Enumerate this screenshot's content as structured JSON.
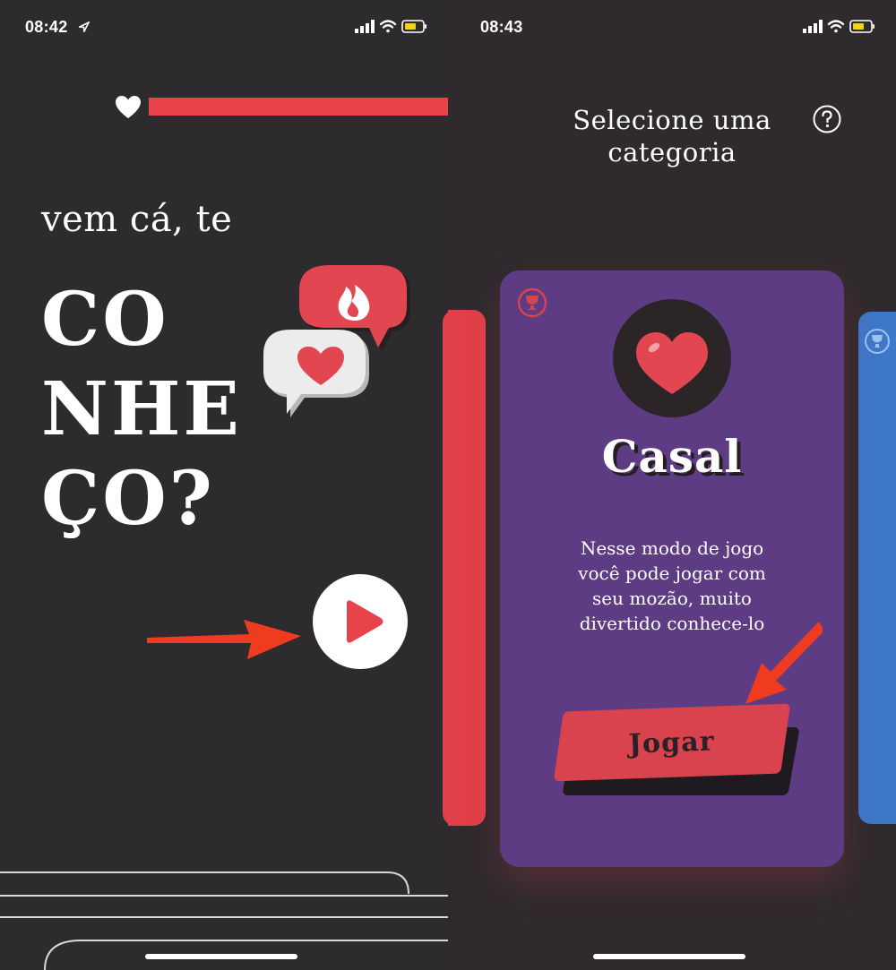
{
  "left_screen": {
    "status": {
      "time": "08:42"
    },
    "intro": "vem cá, te",
    "big_lines": [
      "CO",
      "NHE",
      "ÇO?"
    ],
    "icons": {
      "progress": "heart-icon",
      "bubble_top": "fire-icon",
      "bubble_bottom": "heart-icon",
      "play": "play-icon"
    },
    "progress": 1.0
  },
  "right_screen": {
    "status": {
      "time": "08:43"
    },
    "title_lines": [
      "Selecione uma",
      "categoria"
    ],
    "help_icon": "question-circle-icon",
    "card": {
      "title": "Casal",
      "description_lines": [
        "Nesse modo de jogo",
        "você pode jogar com",
        "seu mozão, muito",
        "divertido conhece-lo"
      ],
      "button_label": "Jogar",
      "icon": "heart-icon",
      "badge_icon": "trophy-icon"
    }
  },
  "colors": {
    "background": "#2e2b2e",
    "accent_red": "#e8434a",
    "card_purple": "#5e3c83",
    "card_blue": "#3d78c9",
    "annotation_arrow": "#ef3b1f"
  }
}
